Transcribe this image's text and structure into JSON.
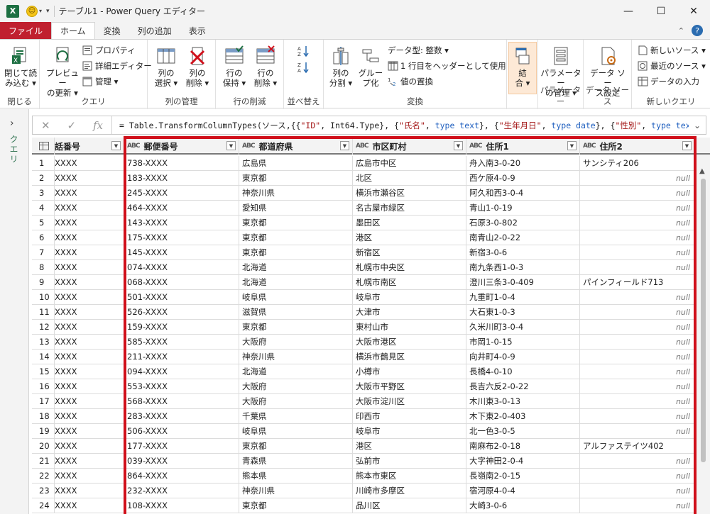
{
  "window": {
    "title": "テーブル1 - Power Query エディター",
    "app_icon": "X",
    "controls": [
      "—",
      "☐",
      "✕"
    ]
  },
  "tabs": [
    {
      "label": "ファイル"
    },
    {
      "label": "ホーム"
    },
    {
      "label": "変換"
    },
    {
      "label": "列の追加"
    },
    {
      "label": "表示"
    }
  ],
  "ribbon": {
    "close": {
      "label1": "閉じて読",
      "label2": "み込む ▾",
      "group": "閉じる"
    },
    "query": {
      "preview_label1": "プレビュー",
      "preview_label2": "の更新 ▾",
      "properties": "プロパティ",
      "advanced_editor": "詳細エディター",
      "manage": "管理 ▾",
      "group": "クエリ"
    },
    "columns": {
      "choose_label1": "列の",
      "choose_label2": "選択 ▾",
      "remove_label1": "列の",
      "remove_label2": "削除 ▾",
      "group": "列の管理"
    },
    "rows": {
      "keep_label1": "行の",
      "keep_label2": "保持 ▾",
      "remove_label1": "行の",
      "remove_label2": "削除 ▾",
      "group": "行の削減"
    },
    "sort": {
      "group": "並べ替え"
    },
    "transform": {
      "split_label1": "列の",
      "split_label2": "分割 ▾",
      "group_label1": "グルー",
      "group_label2": "プ化",
      "datatype": "データ型: 整数 ▾",
      "first_row_header": "1 行目をヘッダーとして使用 ▾",
      "replace_values": "値の置換",
      "group": "変換"
    },
    "combine": {
      "label1": "結",
      "label2": "合 ▾"
    },
    "parameters": {
      "label1": "パラメーター",
      "label2": "の管理 ▾",
      "group": "パラメーター"
    },
    "datasource": {
      "label1": "データ ソー",
      "label2": "ス設定",
      "group": "データ ソース"
    },
    "newquery": {
      "new_source": "新しいソース ▾",
      "recent_sources": "最近のソース ▾",
      "enter_data": "データの入力",
      "group": "新しいクエリ"
    }
  },
  "query_pane": {
    "label": "クエリ"
  },
  "formula": {
    "p1": "= Table.TransformColumnTypes(ソース,{{",
    "s1": "\"ID\"",
    "p2": ", Int64.Type}, {",
    "s2": "\"氏名\"",
    "p3": ", ",
    "k1": "type text",
    "p4": "}, {",
    "s3": "\"生年月日\"",
    "p5": ", ",
    "k2": "type date",
    "p6": "}, {",
    "s4": "\"性別\"",
    "p7": ", ",
    "k3": "type text"
  },
  "table": {
    "columns": [
      "話番号",
      "郵便番号",
      "都道府県",
      "市区町村",
      "住所1",
      "住所2"
    ],
    "type_icon": "ABC",
    "null_text": "null",
    "rows": [
      [
        "1",
        "XXXX",
        "738-XXXX",
        "広島県",
        "広島市中区",
        "舟入南3-0-20",
        "サンシティ206"
      ],
      [
        "2",
        "XXXX",
        "183-XXXX",
        "東京都",
        "北区",
        "西ケ原4-0-9",
        null
      ],
      [
        "3",
        "XXXX",
        "245-XXXX",
        "神奈川県",
        "横浜市瀬谷区",
        "阿久和西3-0-4",
        null
      ],
      [
        "4",
        "XXXX",
        "464-XXXX",
        "愛知県",
        "名古屋市緑区",
        "青山1-0-19",
        null
      ],
      [
        "5",
        "XXXX",
        "143-XXXX",
        "東京都",
        "墨田区",
        "石原3-0-802",
        null
      ],
      [
        "6",
        "XXXX",
        "175-XXXX",
        "東京都",
        "港区",
        "南青山2-0-22",
        null
      ],
      [
        "7",
        "XXXX",
        "145-XXXX",
        "東京都",
        "新宿区",
        "新宿3-0-6",
        null
      ],
      [
        "8",
        "XXXX",
        "074-XXXX",
        "北海道",
        "札幌市中央区",
        "南九条西1-0-3",
        null
      ],
      [
        "9",
        "XXXX",
        "068-XXXX",
        "北海道",
        "札幌市南区",
        "澄川三条3-0-409",
        "パインフィールド713"
      ],
      [
        "10",
        "XXXX",
        "501-XXXX",
        "岐阜県",
        "岐阜市",
        "九重町1-0-4",
        null
      ],
      [
        "11",
        "XXXX",
        "526-XXXX",
        "滋賀県",
        "大津市",
        "大石東1-0-3",
        null
      ],
      [
        "12",
        "XXXX",
        "159-XXXX",
        "東京都",
        "東村山市",
        "久米川町3-0-4",
        null
      ],
      [
        "13",
        "XXXX",
        "585-XXXX",
        "大阪府",
        "大阪市港区",
        "市岡1-0-15",
        null
      ],
      [
        "14",
        "XXXX",
        "211-XXXX",
        "神奈川県",
        "横浜市鶴見区",
        "向井町4-0-9",
        null
      ],
      [
        "15",
        "XXXX",
        "094-XXXX",
        "北海道",
        "小樽市",
        "長橋4-0-10",
        null
      ],
      [
        "16",
        "XXXX",
        "553-XXXX",
        "大阪府",
        "大阪市平野区",
        "長吉六反2-0-22",
        null
      ],
      [
        "17",
        "XXXX",
        "568-XXXX",
        "大阪府",
        "大阪市淀川区",
        "木川東3-0-13",
        null
      ],
      [
        "18",
        "XXXX",
        "283-XXXX",
        "千葉県",
        "印西市",
        "木下東2-0-403",
        null
      ],
      [
        "19",
        "XXXX",
        "506-XXXX",
        "岐阜県",
        "岐阜市",
        "北一色3-0-5",
        null
      ],
      [
        "20",
        "XXXX",
        "177-XXXX",
        "東京都",
        "港区",
        "南麻布2-0-18",
        "アルファステイツ402"
      ],
      [
        "21",
        "XXXX",
        "039-XXXX",
        "青森県",
        "弘前市",
        "大字神田2-0-4",
        null
      ],
      [
        "22",
        "XXXX",
        "864-XXXX",
        "熊本県",
        "熊本市東区",
        "長嶺南2-0-15",
        null
      ],
      [
        "23",
        "XXXX",
        "232-XXXX",
        "神奈川県",
        "川崎市多摩区",
        "宿河原4-0-4",
        null
      ],
      [
        "24",
        "XXXX",
        "108-XXXX",
        "東京都",
        "品川区",
        "大崎3-0-6",
        null
      ]
    ]
  },
  "colors": {
    "file_tab": "#c0202f",
    "highlight": "#d0101b",
    "excel": "#1d6f42"
  }
}
